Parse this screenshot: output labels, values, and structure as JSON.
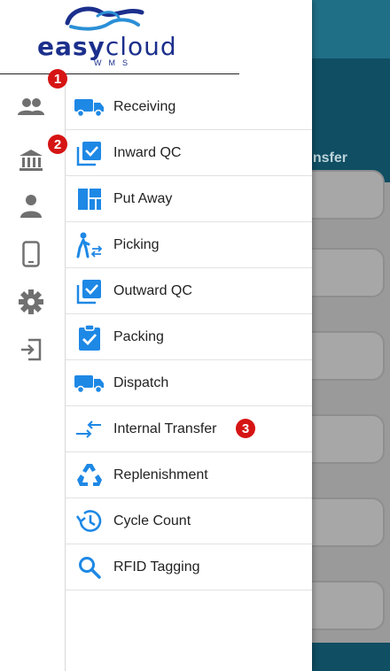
{
  "brand": {
    "name_bold": "easy",
    "name_light": "cloud",
    "subtitle": "WMS"
  },
  "background": {
    "header_title": "nsfer"
  },
  "rail": [
    {
      "icon": "users-icon"
    },
    {
      "icon": "bank-icon"
    },
    {
      "icon": "user-icon"
    },
    {
      "icon": "mobile-icon"
    },
    {
      "icon": "gear-icon"
    },
    {
      "icon": "logout-icon"
    }
  ],
  "menu": [
    {
      "label": "Receiving",
      "icon": "truck-icon"
    },
    {
      "label": "Inward QC",
      "icon": "checkbox-icon"
    },
    {
      "label": "Put Away",
      "icon": "dashboard-icon"
    },
    {
      "label": "Picking",
      "icon": "person-transfer-icon"
    },
    {
      "label": "Outward QC",
      "icon": "checkbox-icon"
    },
    {
      "label": "Packing",
      "icon": "clipboard-check-icon"
    },
    {
      "label": "Dispatch",
      "icon": "truck-icon"
    },
    {
      "label": "Internal Transfer",
      "icon": "arrows-icon"
    },
    {
      "label": "Replenishment",
      "icon": "recycle-icon"
    },
    {
      "label": "Cycle Count",
      "icon": "history-icon"
    },
    {
      "label": "RFID Tagging",
      "icon": "search-icon"
    }
  ],
  "annotations": [
    "1",
    "2",
    "3"
  ],
  "colors": {
    "accent": "#1e88e5",
    "badge": "#d61414",
    "brand": "#1b2f8c"
  }
}
